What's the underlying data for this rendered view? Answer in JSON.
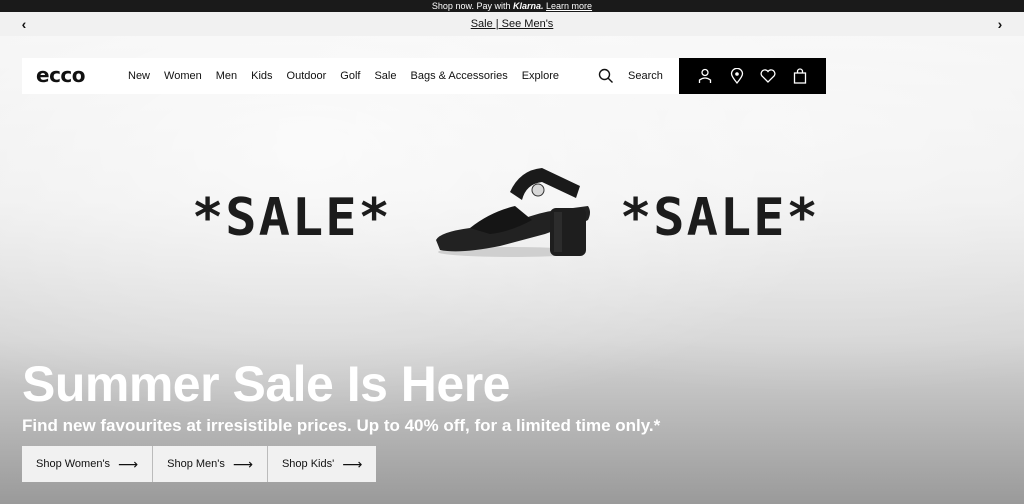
{
  "topbar": {
    "prefix": "Shop now. Pay with",
    "brand": "Klarna.",
    "link": "Learn more"
  },
  "promo": {
    "text": "Sale | See Men's",
    "prev_icon": "chevron-left-icon",
    "next_icon": "chevron-right-icon"
  },
  "header": {
    "logo": "ecco",
    "nav": [
      "New",
      "Women",
      "Men",
      "Kids",
      "Outdoor",
      "Golf",
      "Sale",
      "Bags & Accessories",
      "Explore"
    ],
    "search_label": "Search",
    "icons": [
      "account-icon",
      "store-locator-icon",
      "wishlist-icon",
      "bag-icon"
    ]
  },
  "hero": {
    "sale_left": "*SALE*",
    "sale_right": "*SALE*",
    "headline": "Summer Sale Is Here",
    "subline": "Find new favourites at irresistible prices. Up to 40% off, for a limited time only.*",
    "ctas": [
      {
        "label": "Shop Women's"
      },
      {
        "label": "Shop Men's"
      },
      {
        "label": "Shop Kids'"
      }
    ]
  }
}
